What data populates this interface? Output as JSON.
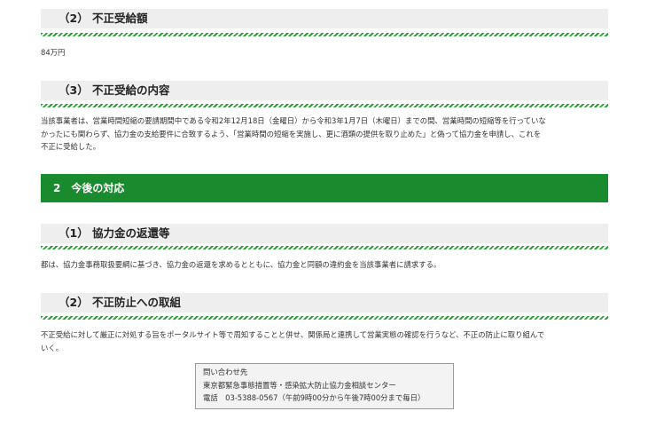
{
  "sections": {
    "amount_heading": "（2） 不正受給額",
    "amount_value": "84万円",
    "content_heading": "（3） 不正受給の内容",
    "content_text_1": "当該事業者は、営業時間短縮の要請期間中である令和2年12月18日（金曜日）から令和3年1月7日（木曜日）までの間、営業時間の短縮等を行っていな",
    "content_text_2": "かったにも関わらず、協力金の支給要件に合致するよう、「営業時間の短縮を実施し、更に酒類の提供を取り止めた」と偽って協力金を申請し、これを",
    "content_text_3": "不正に受給した。",
    "response_heading": "2　今後の対応",
    "refund_heading": "（1） 協力金の返還等",
    "refund_text": "都は、協力金事務取扱要綱に基づき、協力金の返還を求めるとともに、協力金と同額の違約金を当該事業者に請求する。",
    "prevention_heading": "（2） 不正防止への取組",
    "prevention_text_1": "不正受給に対して厳正に対処する旨をポータルサイト等で周知することと併せ、関係局と連携して営業実態の確認を行うなど、不正の防止に取り組んで",
    "prevention_text_2": "いく。"
  },
  "contact": {
    "title": "問い合わせ先",
    "organization": "東京都緊急事態措置等・感染拡大防止協力金相談センター",
    "phone": "電話　03-5388-0567（午前9時00分から午後7時00分まで毎日）"
  },
  "colors": {
    "accent_green": "#1a8a2e",
    "stripe_green": "#2e9e3a",
    "heading_bg": "#eeeeee"
  }
}
